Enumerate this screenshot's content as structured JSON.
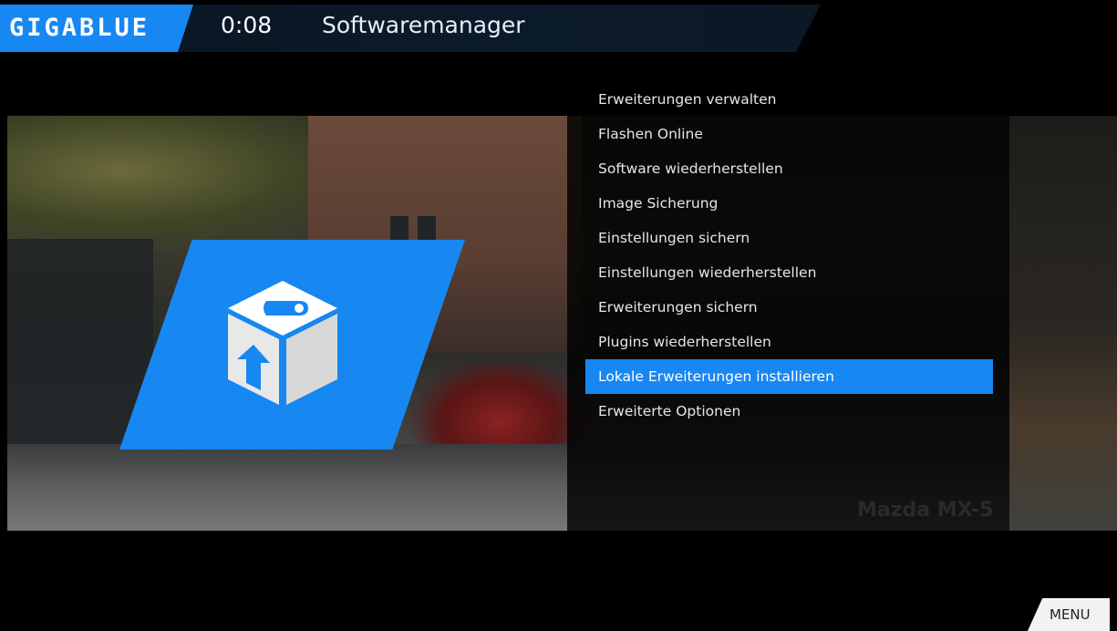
{
  "header": {
    "logo": "GIGABLUE",
    "clock": "0:08",
    "title": "Softwaremanager"
  },
  "menu": {
    "items": [
      "Erweiterungen verwalten",
      "Flashen Online",
      "Software wiederherstellen",
      "Image Sicherung",
      "Einstellungen sichern",
      "Einstellungen wiederherstellen",
      "Erweiterungen sichern",
      "Plugins wiederherstellen",
      "Lokale Erweiterungen installieren",
      "Erweiterte Optionen"
    ],
    "selected_index": 8
  },
  "background": {
    "watermark": "Mazda MX-5"
  },
  "footer": {
    "menu_key": "MENU"
  },
  "icons": {
    "main": "software-package-cube-icon"
  },
  "colors": {
    "accent": "#1787f2",
    "background": "#000000",
    "text": "#e6e6e6"
  }
}
